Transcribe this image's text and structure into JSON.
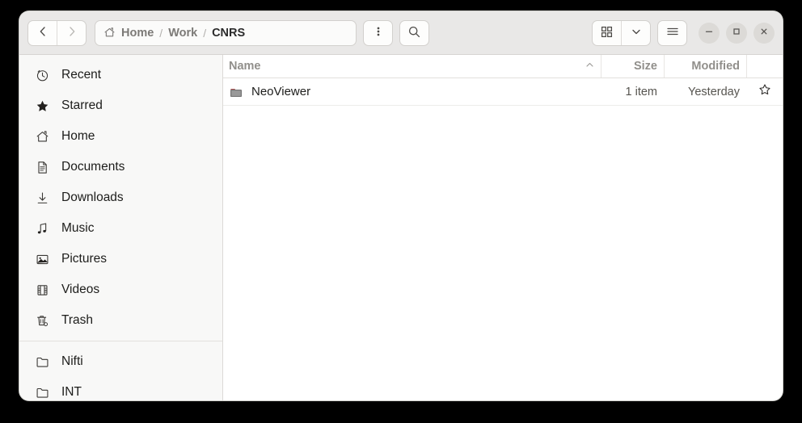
{
  "window": {
    "controls": {
      "minimize_label": "Minimize",
      "maximize_label": "Maximize",
      "close_label": "Close"
    }
  },
  "header": {
    "nav": {
      "back_label": "Back",
      "forward_label": "Forward"
    },
    "breadcrumb": {
      "home_icon": "home-icon",
      "items": [
        "Home",
        "Work",
        "CNRS"
      ],
      "separator": "/",
      "current_index": 2
    },
    "menu_button_icon": "vertical-dots-icon",
    "search_button_icon": "search-icon",
    "view_grid_icon": "grid-view-icon",
    "view_dropdown_icon": "chevron-down-icon",
    "main_menu_icon": "hamburger-menu-icon"
  },
  "sidebar": {
    "groups": [
      {
        "items": [
          {
            "label": "Recent",
            "icon": "clock-icon"
          },
          {
            "label": "Starred",
            "icon": "star-icon"
          },
          {
            "label": "Home",
            "icon": "home-icon"
          },
          {
            "label": "Documents",
            "icon": "document-icon"
          },
          {
            "label": "Downloads",
            "icon": "download-icon"
          },
          {
            "label": "Music",
            "icon": "music-note-icon"
          },
          {
            "label": "Pictures",
            "icon": "image-icon"
          },
          {
            "label": "Videos",
            "icon": "film-icon"
          },
          {
            "label": "Trash",
            "icon": "trash-icon"
          }
        ]
      },
      {
        "items": [
          {
            "label": "Nifti",
            "icon": "folder-outline-icon"
          },
          {
            "label": "INT",
            "icon": "folder-outline-icon"
          }
        ]
      }
    ]
  },
  "file_list": {
    "columns": {
      "name": "Name",
      "size": "Size",
      "modified": "Modified"
    },
    "sort": {
      "column": "Name",
      "direction": "ascending",
      "indicator_icon": "chevron-up-icon"
    },
    "rows": [
      {
        "name": "NeoViewer",
        "size": "1 item",
        "modified": "Yesterday",
        "icon": "folder-icon",
        "icon_color": "#a13d3d",
        "starred": false,
        "star_icon": "star-outline-icon"
      }
    ]
  },
  "colors": {
    "headerbar_bg": "#e9e8e7",
    "sidebar_bg": "#f8f8f7",
    "content_bg": "#ffffff",
    "text_primary": "#1d1d1b",
    "text_muted": "#918f8b",
    "folder_accent": "#a13d3d"
  }
}
